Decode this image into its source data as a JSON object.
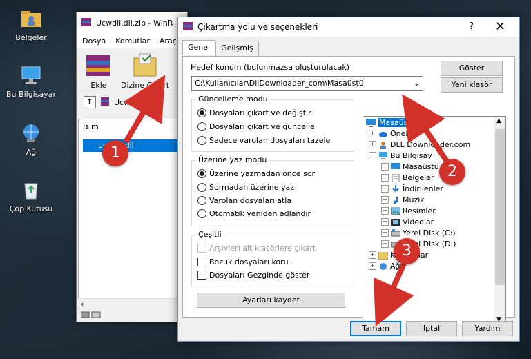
{
  "desktop": {
    "icons": [
      {
        "label": "Belgeler",
        "icon": "folder-user-icon"
      },
      {
        "label": "Bu Bilgisayar",
        "icon": "computer-icon"
      },
      {
        "label": "Ağ",
        "icon": "network-icon"
      },
      {
        "label": "Çöp Kutusu",
        "icon": "recycle-bin-icon"
      }
    ]
  },
  "winrar": {
    "title": "Ucwdll.dll.zip - WinR",
    "menu": [
      "Dosya",
      "Komutlar",
      "Araçla"
    ],
    "tools": [
      {
        "label": "Ekle",
        "icon": "winrar-add-icon"
      },
      {
        "label": "Dizine Çıkart",
        "icon": "extract-to-icon"
      }
    ],
    "path": "Ucwdll.dll.z",
    "column_header": "İsim",
    "selected_file": "ucwdll.dll"
  },
  "dialog": {
    "title": "Çıkartma yolu ve seçenekleri",
    "help_glyph": "?",
    "close_glyph": "✕",
    "tabs": [
      "Genel",
      "Gelişmiş"
    ],
    "dest_label": "Hedef konum (bulunmazsa oluşturulacak)",
    "dest_value": "C:\\Kullanıcılar\\DllDownloader_com\\Masaüstü",
    "show_button": "Göster",
    "new_folder_button": "Yeni klasör",
    "update_group": {
      "title": "Güncelleme modu",
      "options": [
        {
          "label": "Dosyaları çıkart ve değiştir",
          "checked": true
        },
        {
          "label": "Dosyaları çıkart ve güncelle",
          "checked": false
        },
        {
          "label": "Sadece varolan dosyaları tazele",
          "checked": false
        }
      ]
    },
    "overwrite_group": {
      "title": "Üzerine yaz modu",
      "options": [
        {
          "label": "Üzerine yazmadan önce sor",
          "checked": true
        },
        {
          "label": "Sormadan üzerine yaz",
          "checked": false
        },
        {
          "label": "Varolan dosyaları atla",
          "checked": false
        },
        {
          "label": "Otomatik yeniden adlandır",
          "checked": false
        }
      ]
    },
    "misc_group": {
      "title": "Çeşitli",
      "options": [
        {
          "label": "Arşivleri alt klasörlere çıkart",
          "checked": false,
          "disabled": true
        },
        {
          "label": "Bozuk dosyaları koru",
          "checked": false,
          "disabled": false
        },
        {
          "label": "Dosyaları Gezginde göster",
          "checked": false,
          "disabled": false
        }
      ]
    },
    "save_settings_button": "Ayarları kaydet",
    "tree": [
      {
        "label": "Masaüstü",
        "icon": "desktop-icon",
        "selected": true
      },
      {
        "label": "OneD",
        "icon": "onedrive-icon"
      },
      {
        "label": "DLL Downloader.com",
        "icon": "user-icon"
      },
      {
        "label": "Bu Bilgisay",
        "icon": "computer-icon"
      },
      {
        "label": "Masaüstü",
        "icon": "desktop-icon"
      },
      {
        "label": "Belgeler",
        "icon": "documents-icon"
      },
      {
        "label": "İndirilenler",
        "icon": "download-icon"
      },
      {
        "label": "Müzik",
        "icon": "music-icon"
      },
      {
        "label": "Resimler",
        "icon": "pictures-icon"
      },
      {
        "label": "Videolar",
        "icon": "videos-icon"
      },
      {
        "label": "Yerel Disk (C:)",
        "icon": "drive-icon"
      },
      {
        "label": "Yerel Disk (D:)",
        "icon": "drive-icon"
      },
      {
        "label": "Kitaplıklar",
        "icon": "libraries-icon"
      },
      {
        "label": "Ağ",
        "icon": "network-icon"
      }
    ],
    "ok_button": "Tamam",
    "cancel_button": "İptal",
    "help_button": "Yardım"
  },
  "annotations": {
    "step1": "1",
    "step2": "2",
    "step3": "3",
    "color": "#d2322a"
  }
}
